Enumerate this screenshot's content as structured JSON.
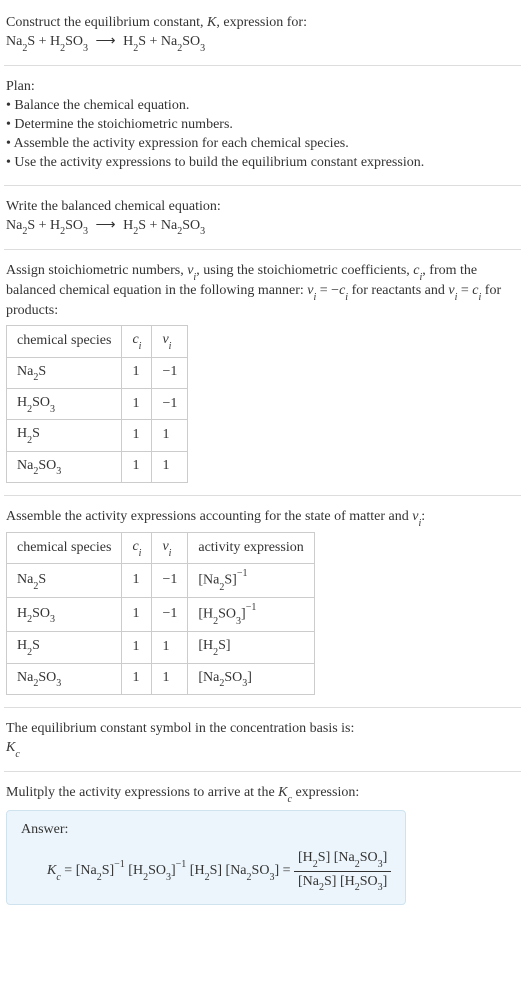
{
  "header": {
    "line1": "Construct the equilibrium constant, ",
    "Ksym": "K",
    "line1b": ", expression for:",
    "eq_lhs_a": "Na",
    "eq_lhs_a2": "2",
    "eq_lhs_b": "S + H",
    "eq_lhs_b2": "2",
    "eq_lhs_c": "SO",
    "eq_lhs_c3": "3",
    "arrow": "⟶",
    "eq_rhs_a": "H",
    "eq_rhs_a2": "2",
    "eq_rhs_b": "S + Na",
    "eq_rhs_b2": "2",
    "eq_rhs_c": "SO",
    "eq_rhs_c3": "3"
  },
  "plan": {
    "title": "Plan:",
    "items": [
      "Balance the chemical equation.",
      "Determine the stoichiometric numbers.",
      "Assemble the activity expression for each chemical species.",
      "Use the activity expressions to build the equilibrium constant expression."
    ]
  },
  "balanced": {
    "title": "Write the balanced chemical equation:"
  },
  "assign": {
    "l1a": "Assign stoichiometric numbers, ",
    "nu": "ν",
    "sub_i": "i",
    "l1b": ", using the stoichiometric coefficients, ",
    "c": "c",
    "l1c": ", from the balanced chemical equation in the following manner: ",
    "eq1": " = −",
    "eq1b": " for reactants and ",
    "eq2": " = ",
    "eq2b": " for products:"
  },
  "table1": {
    "h1": "chemical species",
    "h2": "c",
    "h2s": "i",
    "h3": "ν",
    "h3s": "i",
    "rows": [
      {
        "sp_a": "Na",
        "sp_a2": "2",
        "sp_b": "S",
        "c": "1",
        "nu": "−1"
      },
      {
        "sp_a": "H",
        "sp_a2": "2",
        "sp_b": "SO",
        "sp_b2": "3",
        "c": "1",
        "nu": "−1"
      },
      {
        "sp_a": "H",
        "sp_a2": "2",
        "sp_b": "S",
        "c": "1",
        "nu": "1"
      },
      {
        "sp_a": "Na",
        "sp_a2": "2",
        "sp_b": "SO",
        "sp_b2": "3",
        "c": "1",
        "nu": "1"
      }
    ]
  },
  "assemble": {
    "l1": "Assemble the activity expressions accounting for the state of matter and ",
    "nu": "ν",
    "sub_i": "i",
    "colon": ":"
  },
  "table2": {
    "h1": "chemical species",
    "h2": "c",
    "h2s": "i",
    "h3": "ν",
    "h3s": "i",
    "h4": "activity expression",
    "rows": [
      {
        "sp_a": "Na",
        "sp_a2": "2",
        "sp_b": "S",
        "c": "1",
        "nu": "−1",
        "ae_a": "[Na",
        "ae_a2": "2",
        "ae_b": "S]",
        "ae_exp": "−1"
      },
      {
        "sp_a": "H",
        "sp_a2": "2",
        "sp_b": "SO",
        "sp_b2": "3",
        "c": "1",
        "nu": "−1",
        "ae_a": "[H",
        "ae_a2": "2",
        "ae_b": "SO",
        "ae_b2": "3",
        "ae_c": "]",
        "ae_exp": "−1"
      },
      {
        "sp_a": "H",
        "sp_a2": "2",
        "sp_b": "S",
        "c": "1",
        "nu": "1",
        "ae_a": "[H",
        "ae_a2": "2",
        "ae_b": "S]"
      },
      {
        "sp_a": "Na",
        "sp_a2": "2",
        "sp_b": "SO",
        "sp_b2": "3",
        "c": "1",
        "nu": "1",
        "ae_a": "[Na",
        "ae_a2": "2",
        "ae_b": "SO",
        "ae_b2": "3",
        "ae_c": "]"
      }
    ]
  },
  "symbol": {
    "l1": "The equilibrium constant symbol in the concentration basis is:",
    "K": "K",
    "Ks": "c"
  },
  "multiply": {
    "l1": "Mulitply the activity expressions to arrive at the ",
    "K": "K",
    "Ks": "c",
    "l2": " expression:"
  },
  "answer": {
    "label": "Answer:",
    "K": "K",
    "Ks": "c",
    "eq": " = ",
    "t1a": "[Na",
    "t1a2": "2",
    "t1b": "S]",
    "t1e": "−1",
    "t2a": "[H",
    "t2a2": "2",
    "t2b": "SO",
    "t2b2": "3",
    "t2c": "]",
    "t2e": "−1",
    "t3a": "[H",
    "t3a2": "2",
    "t3b": "S]",
    "t4a": "[Na",
    "t4a2": "2",
    "t4b": "SO",
    "t4b2": "3",
    "t4c": "]",
    "eq2": " = ",
    "num_a": "[H",
    "num_a2": "2",
    "num_b": "S] [Na",
    "num_b2": "2",
    "num_c": "SO",
    "num_c2": "3",
    "num_d": "]",
    "den_a": "[Na",
    "den_a2": "2",
    "den_b": "S] [H",
    "den_b2": "2",
    "den_c": "SO",
    "den_c2": "3",
    "den_d": "]"
  }
}
